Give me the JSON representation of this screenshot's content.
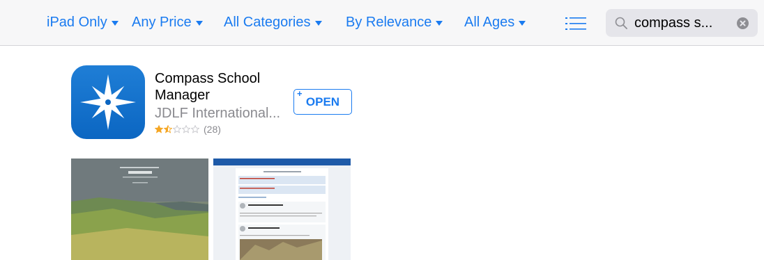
{
  "filters": [
    {
      "label": "iPad Only"
    },
    {
      "label": "Any Price"
    },
    {
      "label": "All Categories"
    },
    {
      "label": "By Relevance"
    },
    {
      "label": "All Ages"
    }
  ],
  "search": {
    "query": "compass s..."
  },
  "app": {
    "title": "Compass School Manager",
    "developer": "JDLF International...",
    "rating_value": 1.5,
    "rating_max": 5,
    "rating_count": "(28)",
    "action_label": "OPEN",
    "action_plus": "+"
  },
  "colors": {
    "accent": "#1a7bf0",
    "icon_blue": "#0b66c2",
    "star_filled": "#f5a623",
    "star_empty": "#c7c7cc"
  },
  "icons": {
    "list_view": "list-icon",
    "search": "magnifier-icon",
    "clear": "clear-x-icon",
    "app": "compass-star-icon"
  }
}
